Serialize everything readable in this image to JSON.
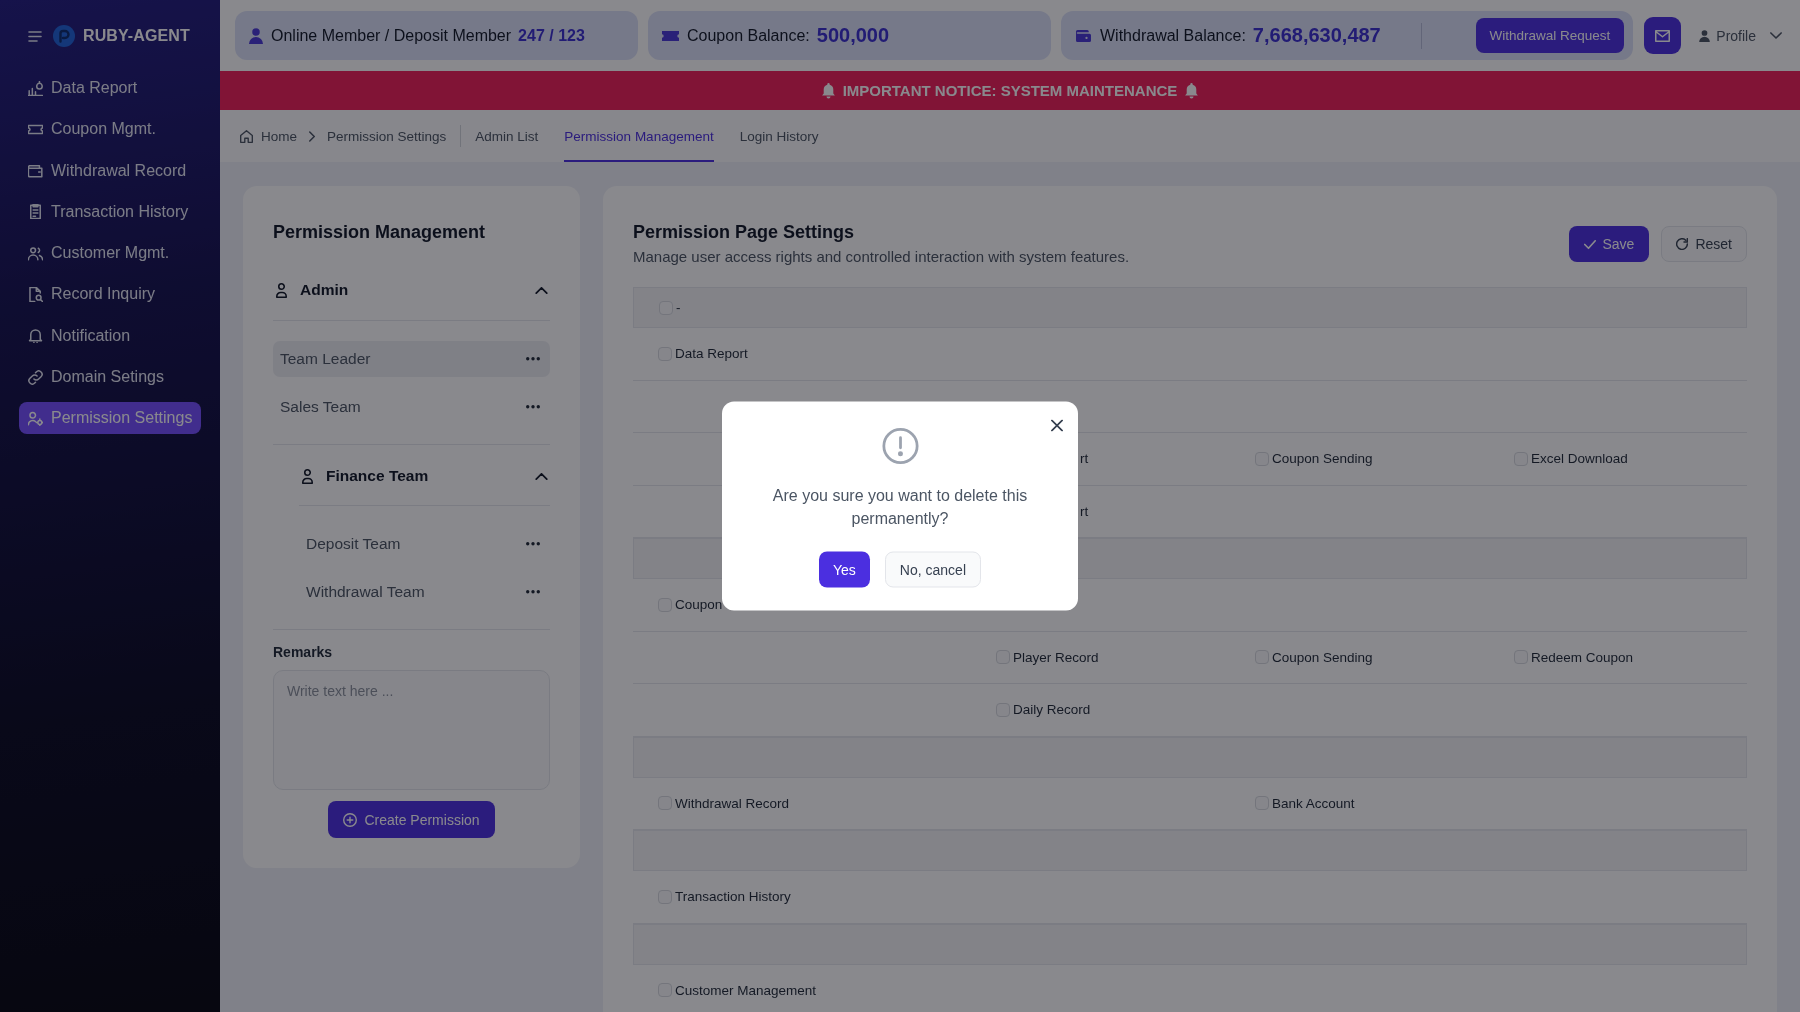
{
  "sidebar": {
    "brand": "RUBY-AGENT",
    "items": [
      {
        "label": "Data Report",
        "selected": false
      },
      {
        "label": "Coupon Mgmt.",
        "selected": false
      },
      {
        "label": "Withdrawal Record",
        "selected": false
      },
      {
        "label": "Transaction History",
        "selected": false
      },
      {
        "label": "Customer Mgmt.",
        "selected": false
      },
      {
        "label": "Record Inquiry",
        "selected": false
      },
      {
        "label": "Notification",
        "selected": false
      },
      {
        "label": "Domain Setings",
        "selected": false
      },
      {
        "label": "Permission Settings",
        "selected": true
      }
    ]
  },
  "topbar": {
    "stats": [
      {
        "label": "Online Member / Deposit Member",
        "value": "247 / 123"
      },
      {
        "label": "Coupon Balance:",
        "value": "500,000"
      },
      {
        "label": "Withdrawal Balance:",
        "value": "7,668,630,487",
        "action": "Withdrawal Request"
      }
    ],
    "profile": "Profile"
  },
  "notice": "IMPORTANT NOTICE: SYSTEM MAINTENANCE",
  "breadcrumb": [
    "Home",
    "Permission Settings"
  ],
  "tabs": [
    {
      "label": "Admin List",
      "selected": false
    },
    {
      "label": "Permission Management",
      "selected": true
    },
    {
      "label": "Login History",
      "selected": false
    }
  ],
  "permission_management": {
    "title": "Permission Management",
    "tree": [
      {
        "kind": "group",
        "label": "Admin",
        "expanded": true,
        "children": [
          {
            "kind": "role",
            "label": "Team Leader",
            "selected": true
          },
          {
            "kind": "role",
            "label": "Sales Team",
            "selected": false
          },
          {
            "kind": "group",
            "label": "Finance Team",
            "expanded": true,
            "children": [
              {
                "kind": "role",
                "label": "Deposit Team",
                "selected": false
              },
              {
                "kind": "role",
                "label": "Withdrawal Team",
                "selected": false
              }
            ]
          }
        ]
      }
    ],
    "remarks": {
      "label": "Remarks",
      "placeholder": "Write text here ..."
    },
    "create_button": "Create Permission"
  },
  "permission_settings": {
    "title": "Permission Page Settings",
    "subtitle": "Manage user access rights and controlled interaction with system features.",
    "buttons": [
      {
        "label": "Save",
        "kind": "primary"
      },
      {
        "label": "Reset",
        "kind": "secondary"
      }
    ],
    "rows": [
      {
        "kind": "band",
        "cells": [
          {
            "kind": "check",
            "label": "-",
            "checked": false
          }
        ]
      },
      {
        "kind": "row",
        "cells": [
          {
            "kind": "check",
            "label": "Data Report",
            "checked": false
          }
        ]
      },
      {
        "kind": "row"
      },
      {
        "kind": "row",
        "cells": [
          {
            "kind": "blank"
          },
          {
            "kind": "tail",
            "label": "rt"
          },
          {
            "kind": "check",
            "label": "Coupon Sending",
            "checked": false
          },
          {
            "kind": "check",
            "label": "Excel Download",
            "checked": false
          }
        ]
      },
      {
        "kind": "row",
        "cells": [
          {
            "kind": "blank"
          },
          {
            "kind": "tail",
            "label": "rt"
          }
        ]
      },
      {
        "kind": "band"
      },
      {
        "kind": "row",
        "cells": [
          {
            "kind": "check",
            "label": "Coupon",
            "checked": false
          }
        ]
      },
      {
        "kind": "row",
        "cells": [
          {
            "kind": "blank"
          },
          {
            "kind": "check",
            "label": "Player Record",
            "checked": false
          },
          {
            "kind": "check",
            "label": "Coupon Sending",
            "checked": false
          },
          {
            "kind": "check",
            "label": "Redeem Coupon",
            "checked": false
          }
        ]
      },
      {
        "kind": "row",
        "cells": [
          {
            "kind": "blank"
          },
          {
            "kind": "check",
            "label": "Daily Record",
            "checked": false
          }
        ]
      },
      {
        "kind": "band"
      },
      {
        "kind": "row",
        "cells": [
          {
            "kind": "check",
            "label": "Withdrawal Record",
            "checked": false
          },
          {
            "kind": "blank"
          },
          {
            "kind": "check",
            "label": "Bank Account",
            "checked": false
          }
        ]
      },
      {
        "kind": "band"
      },
      {
        "kind": "row",
        "cells": [
          {
            "kind": "check",
            "label": "Transaction History",
            "checked": false
          }
        ]
      },
      {
        "kind": "band"
      },
      {
        "kind": "row",
        "cells": [
          {
            "kind": "check",
            "label": "Customer Management",
            "checked": false
          }
        ]
      }
    ]
  },
  "dialog": {
    "message": "Are you sure you want to delete this permanently?",
    "buttons": [
      {
        "label": "Yes",
        "kind": "confirm"
      },
      {
        "label": "No, cancel",
        "kind": "cancel"
      }
    ]
  }
}
